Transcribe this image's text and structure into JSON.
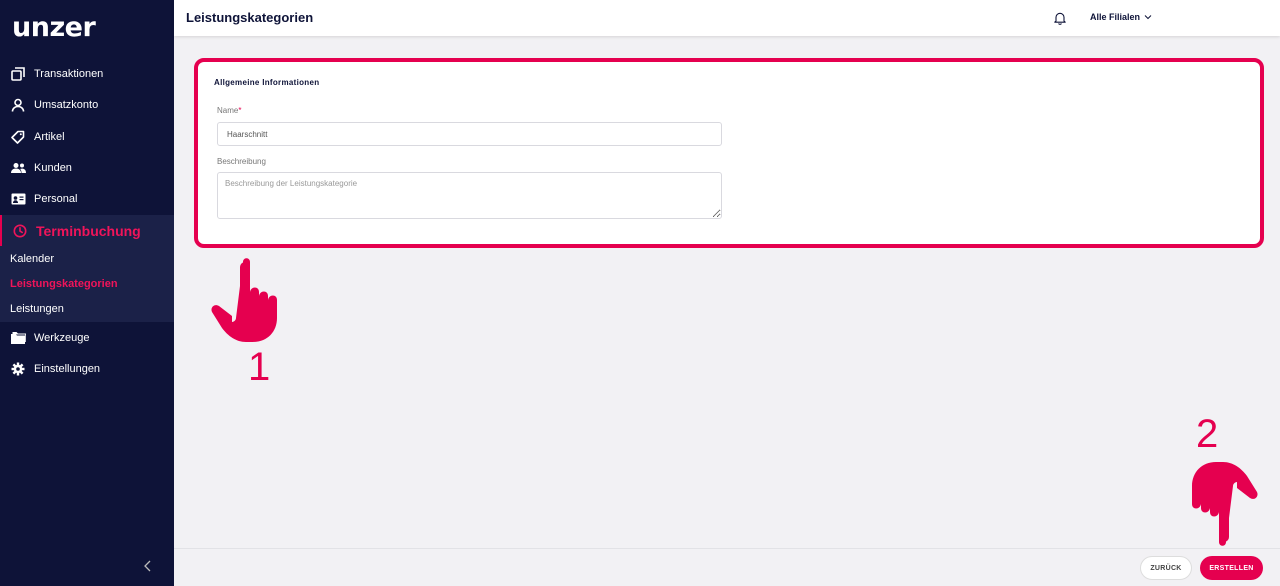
{
  "brand": {
    "logo_text": "unzer",
    "accent_color": "#e5004f",
    "sidebar_color": "#0e1338"
  },
  "sidebar": {
    "items": [
      {
        "label": "Transaktionen",
        "icon": "transactions-icon"
      },
      {
        "label": "Umsatzkonto",
        "icon": "user-icon"
      },
      {
        "label": "Artikel",
        "icon": "tag-icon"
      },
      {
        "label": "Kunden",
        "icon": "people-icon"
      },
      {
        "label": "Personal",
        "icon": "id-card-icon"
      },
      {
        "label": "Terminbuchung",
        "icon": "clock-icon",
        "active": true
      },
      {
        "label": "Werkzeuge",
        "icon": "folder-icon"
      },
      {
        "label": "Einstellungen",
        "icon": "gear-icon"
      }
    ],
    "subitems": [
      {
        "label": "Kalender"
      },
      {
        "label": "Leistungskategorien",
        "active": true
      },
      {
        "label": "Leistungen"
      }
    ]
  },
  "header": {
    "title": "Leistungskategorien",
    "branch_selector": "Alle Filialen"
  },
  "form": {
    "section_title": "Allgemeine Informationen",
    "name_label": "Name",
    "name_required_mark": "*",
    "name_value": "Haarschnitt",
    "description_label": "Beschreibung",
    "description_placeholder": "Beschreibung der Leistungskategorie"
  },
  "annotations": {
    "step1": "1",
    "step2": "2"
  },
  "footer": {
    "back_label": "ZURÜCK",
    "create_label": "ERSTELLEN"
  }
}
